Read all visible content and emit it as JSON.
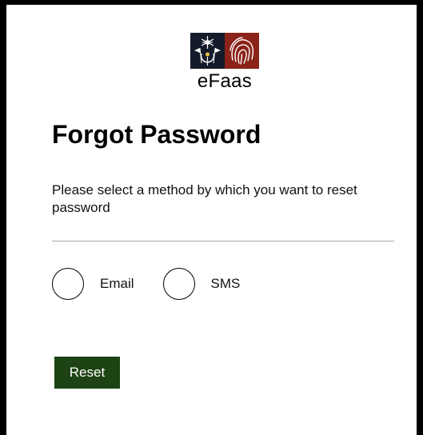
{
  "app": {
    "logo_text": "eFaas"
  },
  "page": {
    "title": "Forgot Password",
    "description": "Please select a method by which you want to reset password"
  },
  "methods": {
    "options": [
      {
        "label": "Email",
        "selected": false
      },
      {
        "label": "SMS",
        "selected": false
      }
    ]
  },
  "actions": {
    "reset_label": "Reset"
  },
  "colors": {
    "button_bg": "#1d4213",
    "emblem_left_bg": "#141c2b",
    "emblem_right_bg": "#8b2318",
    "frame": "#000000"
  },
  "icons": {
    "emblem_left": "maldives-state-emblem-icon",
    "emblem_right": "fingerprint-icon"
  }
}
